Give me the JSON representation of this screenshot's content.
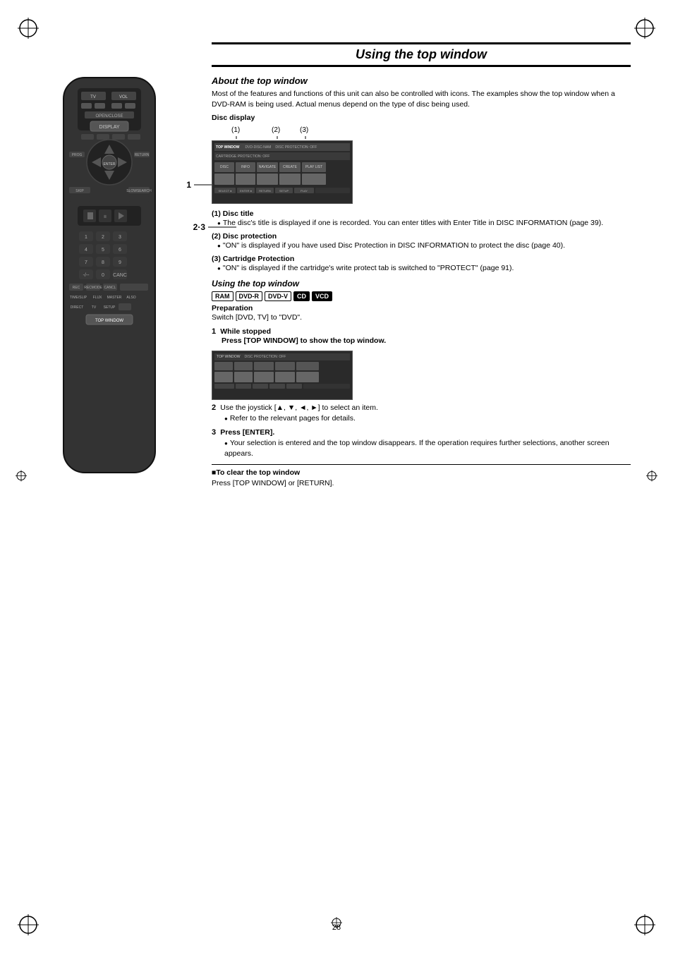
{
  "page": {
    "number": "28",
    "title": "Using the top window",
    "about_section": {
      "heading": "About the top window",
      "body": "Most of the features and functions of this unit can also be controlled with icons. The examples show the top window when a DVD-RAM is being used. Actual menus depend on the type of disc being used.",
      "disc_display_label": "Disc display",
      "labels": [
        "(1)",
        "(2)",
        "(3)"
      ],
      "items": [
        {
          "number": "(1)",
          "title": "Disc title",
          "text": "The disc's title is displayed if one is recorded. You can enter titles with Enter Title in DISC INFORMATION (page 39)."
        },
        {
          "number": "(2)",
          "title": "Disc protection",
          "text": "\"ON\" is displayed if you have used Disc Protection in DISC INFORMATION to protect the disc (page 40)."
        },
        {
          "number": "(3)",
          "title": "Cartridge Protection",
          "text": "\"ON\" is displayed if the cartridge's write protect tab is switched to \"PROTECT\" (page 91)."
        }
      ]
    },
    "using_section": {
      "heading": "Using the top window",
      "badges": [
        "RAM",
        "DVD-R",
        "DVD-V",
        "CD",
        "VCD"
      ],
      "badge_styles": [
        "outline",
        "outline",
        "outline",
        "filled",
        "filled"
      ],
      "preparation_label": "Preparation",
      "preparation_text": "Switch [DVD, TV] to \"DVD\".",
      "steps": [
        {
          "number": "1",
          "title": "While stopped",
          "action": "Press [TOP WINDOW] to show the top window."
        },
        {
          "number": "2",
          "title": "",
          "action": "Use the joystick [▲, ▼, ◄, ►] to select an item.",
          "bullet": "Refer to the relevant pages for details."
        },
        {
          "number": "3",
          "title": "",
          "action": "Press [ENTER].",
          "bullet": "Your selection is entered and the top window disappears. If the operation requires further selections, another screen appears."
        }
      ]
    },
    "clear_section": {
      "title": "■To clear the top window",
      "text": "Press [TOP WINDOW] or [RETURN]."
    },
    "remote_labels": {
      "label1": "1",
      "label2": "2·3"
    }
  }
}
